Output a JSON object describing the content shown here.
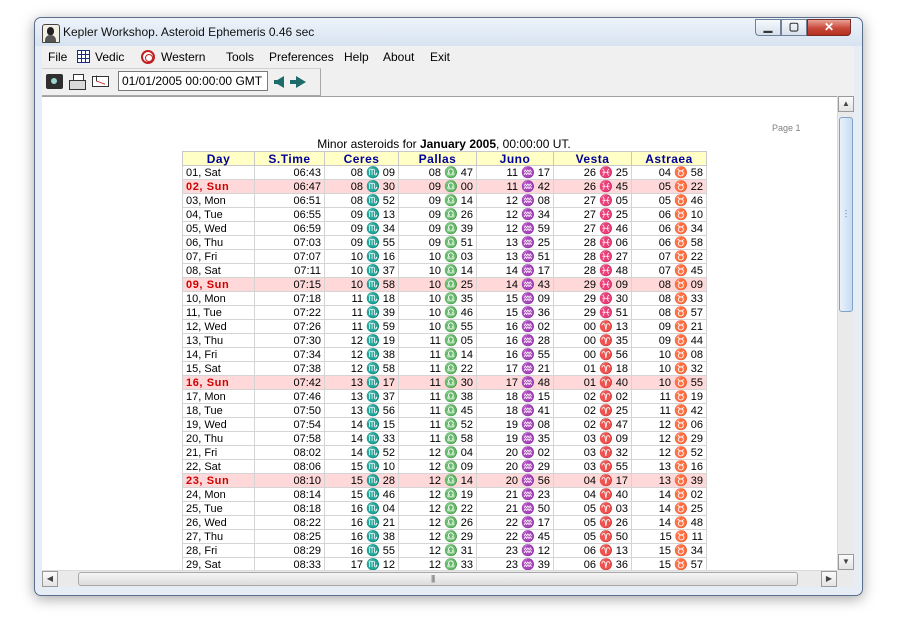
{
  "window": {
    "title": "Kepler Workshop. Asteroid Ephemeris   0.46 sec"
  },
  "menu": {
    "file": "File",
    "vedic": "Vedic",
    "western": "Western",
    "tools": "Tools",
    "preferences": "Preferences",
    "help": "Help",
    "about": "About",
    "exit": "Exit"
  },
  "toolbar": {
    "datetime": "01/01/2005    00:00:00  GMT"
  },
  "report": {
    "page_label": "Page 1",
    "title_prefix": "Minor asteroids for ",
    "title_month": "January 2005",
    "title_suffix": ", 00:00:00 UT.",
    "columns": [
      "Day",
      "S.Time",
      "Ceres",
      "Pallas",
      "Juno",
      "Vesta",
      "Astraea"
    ],
    "rows": [
      {
        "day": "01, Sat",
        "st": "06:43",
        "cells": [
          "08 ♏ 09",
          "08 ♎ 47",
          "11 ♒ 17",
          "26 ♓ 25",
          "04 ♉ 58"
        ],
        "sun": false
      },
      {
        "day": "02, Sun",
        "st": "06:47",
        "cells": [
          "08 ♏ 30",
          "09 ♎ 00",
          "11 ♒ 42",
          "26 ♓ 45",
          "05 ♉ 22"
        ],
        "sun": true
      },
      {
        "day": "03, Mon",
        "st": "06:51",
        "cells": [
          "08 ♏ 52",
          "09 ♎ 14",
          "12 ♒ 08",
          "27 ♓ 05",
          "05 ♉ 46"
        ],
        "sun": false
      },
      {
        "day": "04, Tue",
        "st": "06:55",
        "cells": [
          "09 ♏ 13",
          "09 ♎ 26",
          "12 ♒ 34",
          "27 ♓ 25",
          "06 ♉ 10"
        ],
        "sun": false
      },
      {
        "day": "05, Wed",
        "st": "06:59",
        "cells": [
          "09 ♏ 34",
          "09 ♎ 39",
          "12 ♒ 59",
          "27 ♓ 46",
          "06 ♉ 34"
        ],
        "sun": false
      },
      {
        "day": "06, Thu",
        "st": "07:03",
        "cells": [
          "09 ♏ 55",
          "09 ♎ 51",
          "13 ♒ 25",
          "28 ♓ 06",
          "06 ♉ 58"
        ],
        "sun": false
      },
      {
        "day": "07, Fri",
        "st": "07:07",
        "cells": [
          "10 ♏ 16",
          "10 ♎ 03",
          "13 ♒ 51",
          "28 ♓ 27",
          "07 ♉ 22"
        ],
        "sun": false
      },
      {
        "day": "08, Sat",
        "st": "07:11",
        "cells": [
          "10 ♏ 37",
          "10 ♎ 14",
          "14 ♒ 17",
          "28 ♓ 48",
          "07 ♉ 45"
        ],
        "sun": false
      },
      {
        "day": "09, Sun",
        "st": "07:15",
        "cells": [
          "10 ♏ 58",
          "10 ♎ 25",
          "14 ♒ 43",
          "29 ♓ 09",
          "08 ♉ 09"
        ],
        "sun": true
      },
      {
        "day": "10, Mon",
        "st": "07:18",
        "cells": [
          "11 ♏ 18",
          "10 ♎ 35",
          "15 ♒ 09",
          "29 ♓ 30",
          "08 ♉ 33"
        ],
        "sun": false
      },
      {
        "day": "11, Tue",
        "st": "07:22",
        "cells": [
          "11 ♏ 39",
          "10 ♎ 46",
          "15 ♒ 36",
          "29 ♓ 51",
          "08 ♉ 57"
        ],
        "sun": false
      },
      {
        "day": "12, Wed",
        "st": "07:26",
        "cells": [
          "11 ♏ 59",
          "10 ♎ 55",
          "16 ♒ 02",
          "00 ♈ 13",
          "09 ♉ 21"
        ],
        "sun": false
      },
      {
        "day": "13, Thu",
        "st": "07:30",
        "cells": [
          "12 ♏ 19",
          "11 ♎ 05",
          "16 ♒ 28",
          "00 ♈ 35",
          "09 ♉ 44"
        ],
        "sun": false
      },
      {
        "day": "14, Fri",
        "st": "07:34",
        "cells": [
          "12 ♏ 38",
          "11 ♎ 14",
          "16 ♒ 55",
          "00 ♈ 56",
          "10 ♉ 08"
        ],
        "sun": false
      },
      {
        "day": "15, Sat",
        "st": "07:38",
        "cells": [
          "12 ♏ 58",
          "11 ♎ 22",
          "17 ♒ 21",
          "01 ♈ 18",
          "10 ♉ 32"
        ],
        "sun": false
      },
      {
        "day": "16, Sun",
        "st": "07:42",
        "cells": [
          "13 ♏ 17",
          "11 ♎ 30",
          "17 ♒ 48",
          "01 ♈ 40",
          "10 ♉ 55"
        ],
        "sun": true
      },
      {
        "day": "17, Mon",
        "st": "07:46",
        "cells": [
          "13 ♏ 37",
          "11 ♎ 38",
          "18 ♒ 15",
          "02 ♈ 02",
          "11 ♉ 19"
        ],
        "sun": false
      },
      {
        "day": "18, Tue",
        "st": "07:50",
        "cells": [
          "13 ♏ 56",
          "11 ♎ 45",
          "18 ♒ 41",
          "02 ♈ 25",
          "11 ♉ 42"
        ],
        "sun": false
      },
      {
        "day": "19, Wed",
        "st": "07:54",
        "cells": [
          "14 ♏ 15",
          "11 ♎ 52",
          "19 ♒ 08",
          "02 ♈ 47",
          "12 ♉ 06"
        ],
        "sun": false
      },
      {
        "day": "20, Thu",
        "st": "07:58",
        "cells": [
          "14 ♏ 33",
          "11 ♎ 58",
          "19 ♒ 35",
          "03 ♈ 09",
          "12 ♉ 29"
        ],
        "sun": false
      },
      {
        "day": "21, Fri",
        "st": "08:02",
        "cells": [
          "14 ♏ 52",
          "12 ♎ 04",
          "20 ♒ 02",
          "03 ♈ 32",
          "12 ♉ 52"
        ],
        "sun": false
      },
      {
        "day": "22, Sat",
        "st": "08:06",
        "cells": [
          "15 ♏ 10",
          "12 ♎ 09",
          "20 ♒ 29",
          "03 ♈ 55",
          "13 ♉ 16"
        ],
        "sun": false
      },
      {
        "day": "23, Sun",
        "st": "08:10",
        "cells": [
          "15 ♏ 28",
          "12 ♎ 14",
          "20 ♒ 56",
          "04 ♈ 17",
          "13 ♉ 39"
        ],
        "sun": true
      },
      {
        "day": "24, Mon",
        "st": "08:14",
        "cells": [
          "15 ♏ 46",
          "12 ♎ 19",
          "21 ♒ 23",
          "04 ♈ 40",
          "14 ♉ 02"
        ],
        "sun": false
      },
      {
        "day": "25, Tue",
        "st": "08:18",
        "cells": [
          "16 ♏ 04",
          "12 ♎ 22",
          "21 ♒ 50",
          "05 ♈ 03",
          "14 ♉ 25"
        ],
        "sun": false
      },
      {
        "day": "26, Wed",
        "st": "08:22",
        "cells": [
          "16 ♏ 21",
          "12 ♎ 26",
          "22 ♒ 17",
          "05 ♈ 26",
          "14 ♉ 48"
        ],
        "sun": false
      },
      {
        "day": "27, Thu",
        "st": "08:25",
        "cells": [
          "16 ♏ 38",
          "12 ♎ 29",
          "22 ♒ 45",
          "05 ♈ 50",
          "15 ♉ 11"
        ],
        "sun": false
      },
      {
        "day": "28, Fri",
        "st": "08:29",
        "cells": [
          "16 ♏ 55",
          "12 ♎ 31",
          "23 ♒ 12",
          "06 ♈ 13",
          "15 ♉ 34"
        ],
        "sun": false
      },
      {
        "day": "29, Sat",
        "st": "08:33",
        "cells": [
          "17 ♏ 12",
          "12 ♎ 33",
          "23 ♒ 39",
          "06 ♈ 36",
          "15 ♉ 57"
        ],
        "sun": false
      }
    ]
  },
  "icons": {
    "app": "kepler-portrait-icon",
    "vedic": "vedic-grid-icon",
    "western": "western-wheel-icon",
    "camera": "camera-icon",
    "print": "printer-icon",
    "email": "envelope-icon",
    "prev": "arrow-left-icon",
    "next": "arrow-right-icon"
  }
}
